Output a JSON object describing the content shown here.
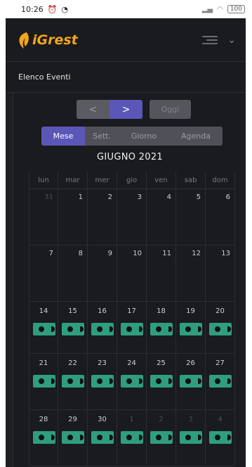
{
  "statusbar": {
    "time": "10:26",
    "battery": "100"
  },
  "header": {
    "brand": "iGrest"
  },
  "section": {
    "title": "Elenco Eventi"
  },
  "nav": {
    "prev": "<",
    "next": ">",
    "today": "Oggi"
  },
  "views": [
    "Mese",
    "Sett.",
    "Giorno",
    "Agenda"
  ],
  "calendar": {
    "month_title": "GIUGNO 2021",
    "weekdays": [
      "lun",
      "mar",
      "mer",
      "gio",
      "ven",
      "sab",
      "dom"
    ],
    "weeks": [
      {
        "days": [
          "31",
          "1",
          "2",
          "3",
          "4",
          "5",
          "6"
        ],
        "other": [
          true,
          false,
          false,
          false,
          false,
          false,
          false
        ],
        "events": false
      },
      {
        "days": [
          "7",
          "8",
          "9",
          "10",
          "11",
          "12",
          "13"
        ],
        "other": [
          false,
          false,
          false,
          false,
          false,
          false,
          false
        ],
        "events": false
      },
      {
        "days": [
          "14",
          "15",
          "16",
          "17",
          "18",
          "19",
          "20"
        ],
        "other": [
          false,
          false,
          false,
          false,
          false,
          false,
          false
        ],
        "events": true
      },
      {
        "days": [
          "21",
          "22",
          "23",
          "24",
          "25",
          "26",
          "27"
        ],
        "other": [
          false,
          false,
          false,
          false,
          false,
          false,
          false
        ],
        "events": true
      },
      {
        "days": [
          "28",
          "29",
          "30",
          "1",
          "2",
          "3",
          "4"
        ],
        "other": [
          false,
          false,
          false,
          true,
          true,
          true,
          true
        ],
        "events": true
      }
    ]
  },
  "colors": {
    "accent": "#5b57b8",
    "event": "#2f9e7e",
    "brand": "#f4a51c"
  }
}
